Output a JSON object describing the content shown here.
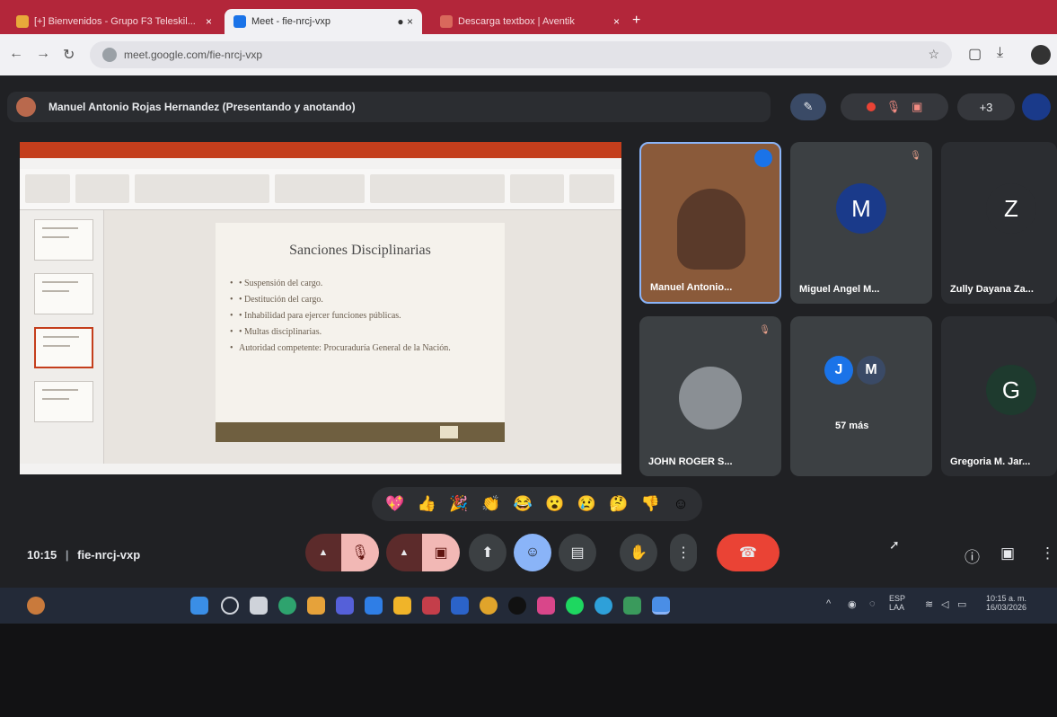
{
  "browser": {
    "tabs": [
      {
        "label": "[+] Bienvenidos - Grupo F3 Teleskil..."
      },
      {
        "label": "Meet - fie-nrcj-vxp",
        "active": true
      },
      {
        "label": "Descarga textbox | Aventik"
      }
    ],
    "url": "meet.google.com/fie-nrcj-vxp"
  },
  "meet": {
    "presenter_label": "Manuel Antonio Rojas Hernandez (Presentando y anotando)",
    "meeting_code": "fie-nrcj-vxp",
    "time": "10:15",
    "clock_separator": "|",
    "top_controls": {
      "count_label": "+3"
    },
    "participants": [
      {
        "name": "Manuel Antonio...",
        "type": "video"
      },
      {
        "name": "Miguel Angel M...",
        "initial": "M",
        "color": "#1a3a8a"
      },
      {
        "name": "Zully Dayana Za...",
        "initial": "Z",
        "color": "#3c4043"
      },
      {
        "name": "JOHN ROGER S...",
        "type": "photo"
      },
      {
        "name": "57 más",
        "initials": [
          "J",
          "M"
        ]
      },
      {
        "name": "Gregoria M. Jar...",
        "initial": "G",
        "color": "#1e3a2e"
      }
    ],
    "reactions": [
      "💖",
      "👍",
      "🎉",
      "👏",
      "😂",
      "😮",
      "😢",
      "🤔",
      "👎",
      "☺"
    ]
  },
  "slide": {
    "title": "Sanciones Disciplinarias",
    "bullets": [
      "• Suspensión del cargo.",
      "• Destitución del cargo.",
      "• Inhabilidad para ejercer funciones públicas.",
      "• Multas disciplinarias.",
      "Autoridad competente: Procuraduría General de la Nación."
    ]
  },
  "taskbar": {
    "lang": "ESP",
    "lang2": "LAA",
    "time": "10:15 a. m.",
    "date": "16/03/2026"
  }
}
